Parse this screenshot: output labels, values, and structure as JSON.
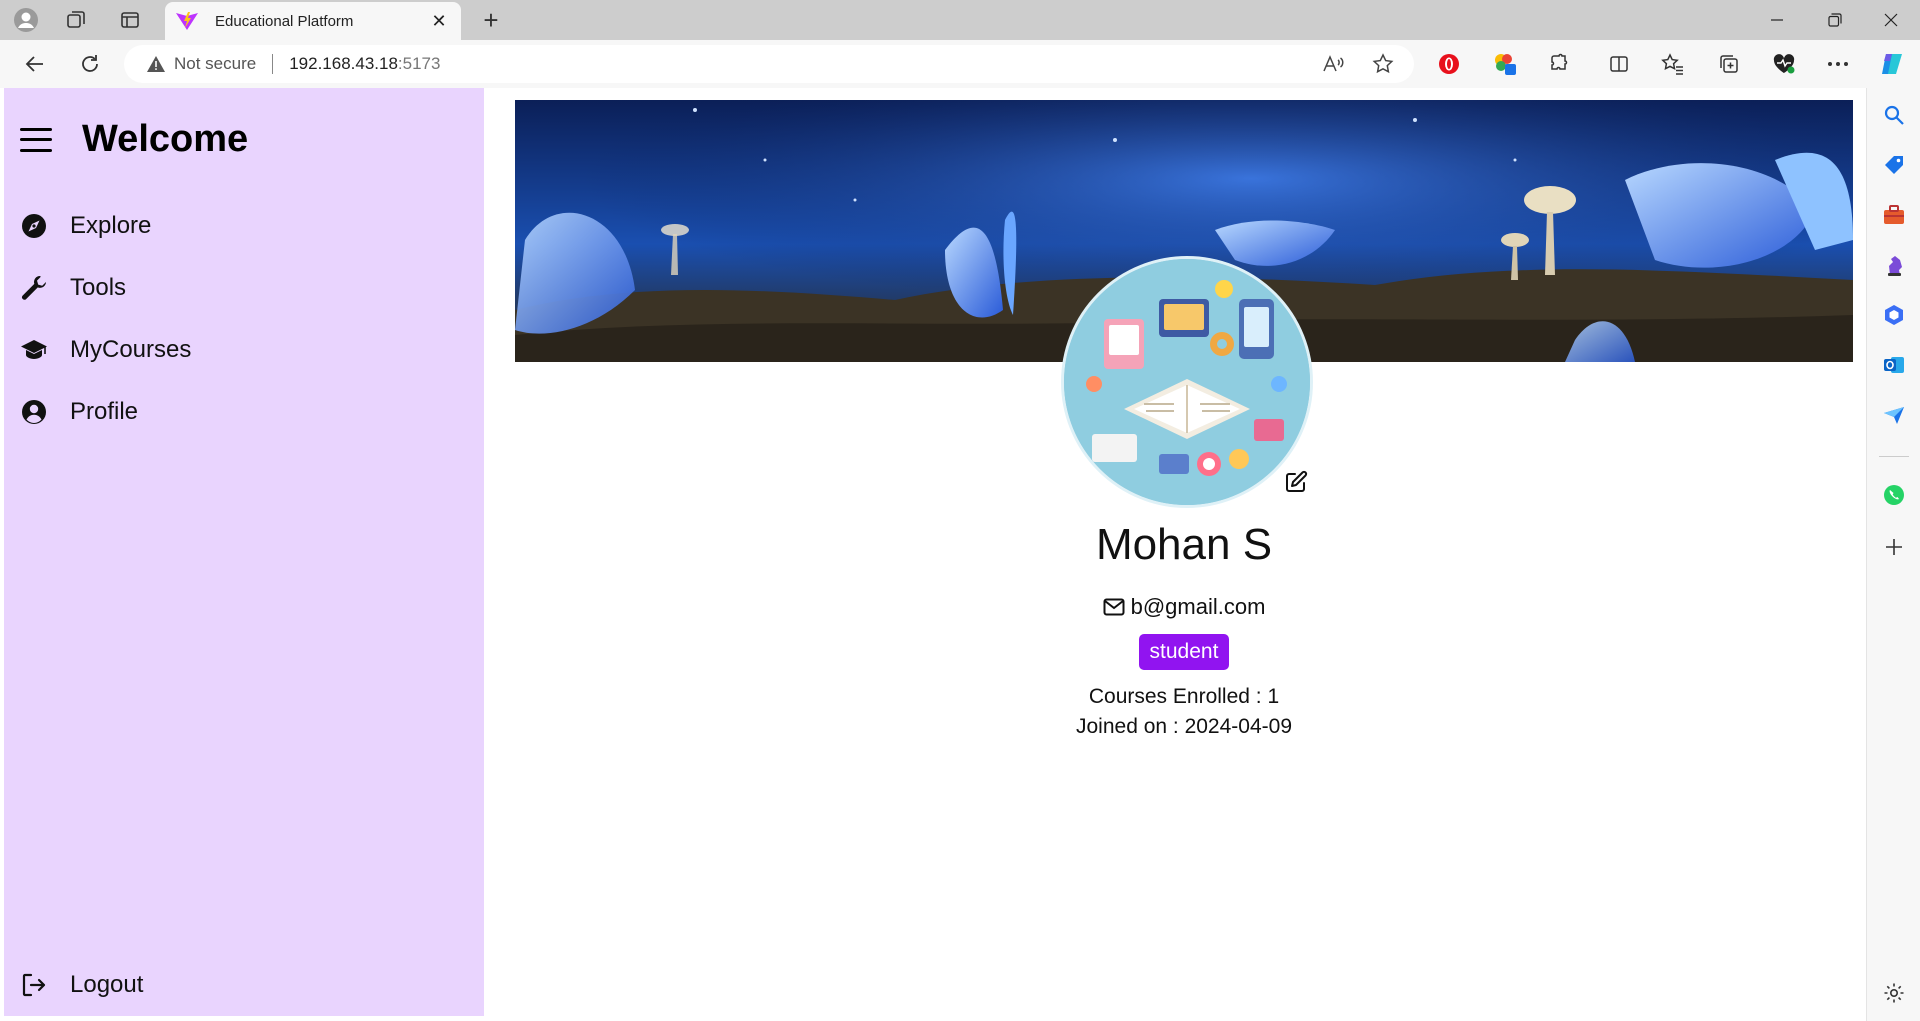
{
  "browser": {
    "tab_title": "Educational Platform",
    "address": {
      "security_label": "Not secure",
      "host": "192.168.43.18",
      "port": ":5173"
    }
  },
  "sidebar": {
    "heading": "Welcome",
    "items": [
      {
        "label": "Explore",
        "icon": "compass-icon"
      },
      {
        "label": "Tools",
        "icon": "wrench-icon"
      },
      {
        "label": "MyCourses",
        "icon": "graduation-cap-icon"
      },
      {
        "label": "Profile",
        "icon": "user-circle-icon"
      }
    ],
    "logout_label": "Logout"
  },
  "profile": {
    "name": "Mohan S",
    "email": "b@gmail.com",
    "role": "student",
    "courses_enrolled": "Courses Enrolled : 1",
    "joined_on": "Joined on : 2024-04-09"
  },
  "colors": {
    "sidebar_bg": "#e9d4fe",
    "role_badge": "#9114f0"
  }
}
